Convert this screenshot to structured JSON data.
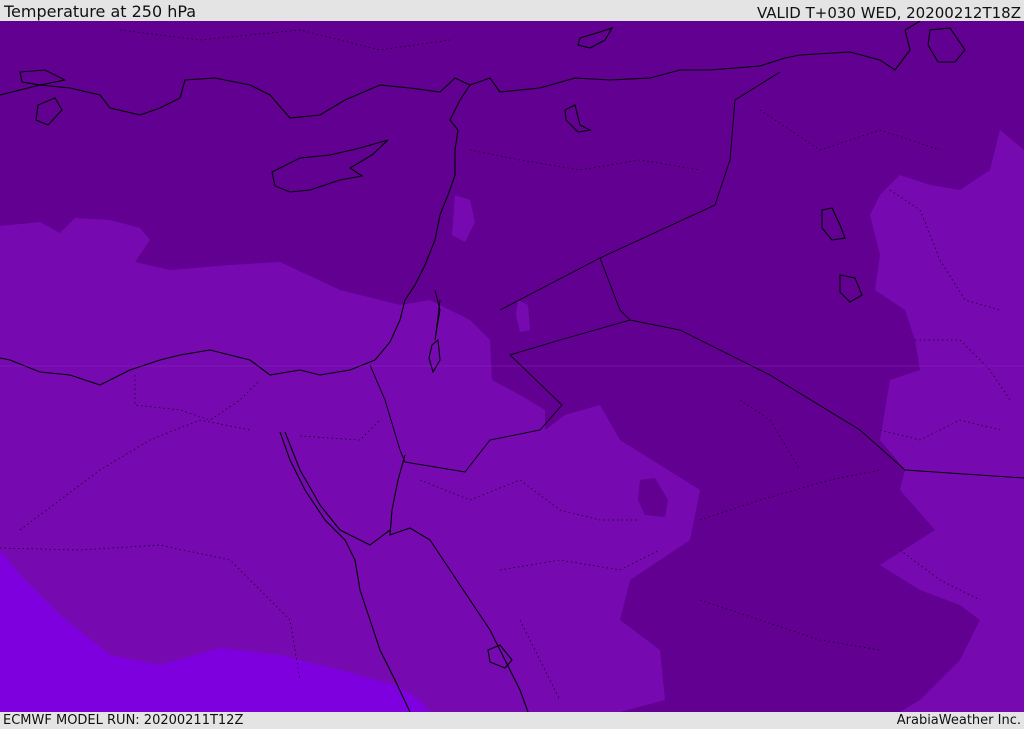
{
  "header": {
    "title": "Temperature at 250 hPa",
    "valid": "VALID T+030 WED, 20200212T18Z"
  },
  "footer": {
    "model_run": "ECMWF MODEL RUN: 20200211T12Z",
    "credit": "ArabiaWeather Inc."
  },
  "colors": {
    "coldest": "#620092",
    "cold": "#760ab0",
    "warm": "#7f00df",
    "coast": "#000000",
    "background": "#e4e4e4"
  },
  "map": {
    "variable": "Temperature",
    "level": "250 hPa",
    "region": "Eastern Mediterranean / Middle East"
  }
}
